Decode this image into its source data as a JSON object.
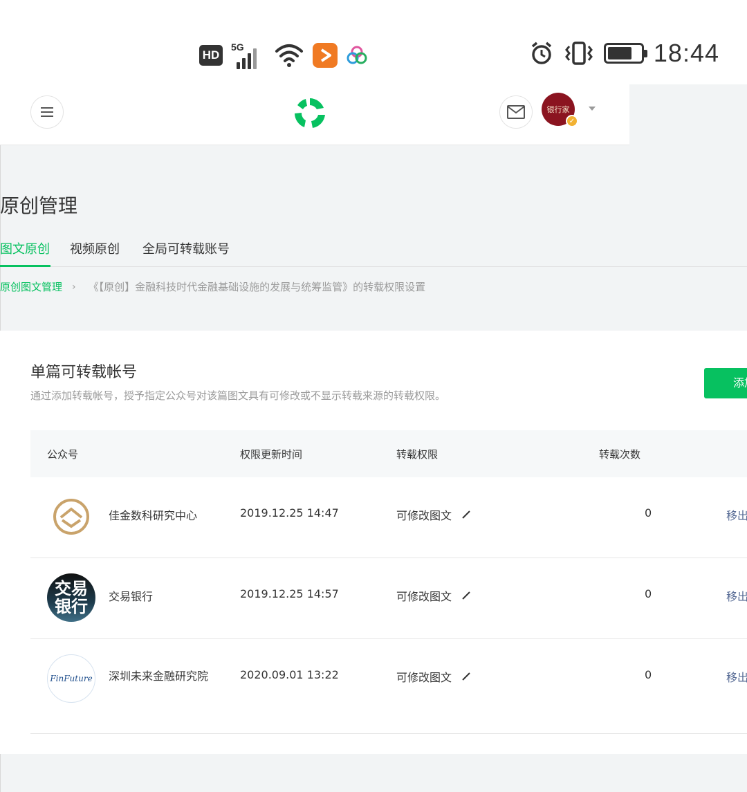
{
  "status_bar": {
    "hd": "HD",
    "network": "5G",
    "time": "18:44",
    "battery_level": 0.75,
    "icons": [
      "hd-icon",
      "signal-icon",
      "wifi-icon",
      "video-app-icon",
      "cloud-app-icon",
      "alarm-icon",
      "vibrate-icon",
      "battery-icon"
    ]
  },
  "header": {
    "menu_icon": "menu-icon",
    "logo_icon": "wechat-platform-logo",
    "mail_icon": "mail-icon",
    "avatar_text": "银行家",
    "avatar_color": "#8b1420"
  },
  "page": {
    "title": "原创管理",
    "tabs": [
      {
        "label": "图文原创",
        "active": true
      },
      {
        "label": "视频原创",
        "active": false
      },
      {
        "label": "全局可转载账号",
        "active": false
      }
    ],
    "breadcrumb": {
      "link": "原创图文管理",
      "separator": "›",
      "current": "《【原创】金融科技时代金融基础设施的发展与统筹监管》的转载权限设置"
    }
  },
  "card": {
    "title": "单篇可转载帐号",
    "description": "通过添加转载帐号，授予指定公众号对该篇图文具有可修改或不显示转载来源的转载权限。",
    "add_button": "添加",
    "columns": [
      "公众号",
      "权限更新时间",
      "转载权限",
      "转载次数"
    ],
    "rows": [
      {
        "account": "佳金数科研究中心",
        "time": "2019.12.25 14:47",
        "permission": "可修改图文",
        "count": "0",
        "action": "移出"
      },
      {
        "account": "交易银行",
        "time": "2019.12.25 14:57",
        "permission": "可修改图文",
        "count": "0",
        "action": "移出"
      },
      {
        "account": "深圳未来金融研究院",
        "time": "2020.09.01 13:22",
        "permission": "可修改图文",
        "count": "0",
        "action": "移出"
      }
    ],
    "logo_texts": {
      "jiaoyi": "交易\n银行",
      "finfuture": "FinFuture"
    }
  },
  "colors": {
    "accent": "#07c160",
    "link": "#576b95",
    "muted": "#9a9a9a"
  }
}
